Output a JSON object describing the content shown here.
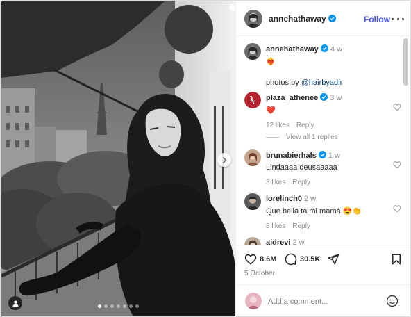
{
  "post": {
    "author": "annehathaway",
    "follow_label": "Follow",
    "more_icon": "more-horizontal-icon",
    "photo_alt_icons": [
      "next-arrow-icon",
      "tag-person-icon"
    ],
    "carousel": {
      "total": 7,
      "active": 1
    }
  },
  "caption": {
    "username": "annehathaway",
    "time": "4 w",
    "emoji": "❤️‍🔥",
    "text_prefix": "photos by ",
    "mention": "@hairbyadir"
  },
  "comments": [
    {
      "username": "plaza_athenee",
      "verified": true,
      "time": "3 w",
      "text": "❤️",
      "likes": "12 likes",
      "reply": "Reply",
      "view_replies": "View all 1 replies"
    },
    {
      "username": "brunabierhals",
      "verified": true,
      "time": "1 w",
      "text": "Lindaaaa deusaaaaa",
      "likes": "3 likes",
      "reply": "Reply"
    },
    {
      "username": "lorelinch0",
      "verified": false,
      "time": "2 w",
      "text": "Que bella ta mi mamá 😍👏",
      "likes": "8 likes",
      "reply": "Reply"
    },
    {
      "username": "aidrevi",
      "verified": false,
      "time": "2 w"
    }
  ],
  "actions": {
    "likes": "8.6M",
    "comments": "30.5K",
    "date": "5 October"
  },
  "add_comment": {
    "placeholder": "Add a comment..."
  },
  "colors": {
    "accent": "#4150f7",
    "verified": "#0095f6",
    "text": "#262626",
    "muted": "#8e8e8e",
    "red": "#ed4956"
  }
}
